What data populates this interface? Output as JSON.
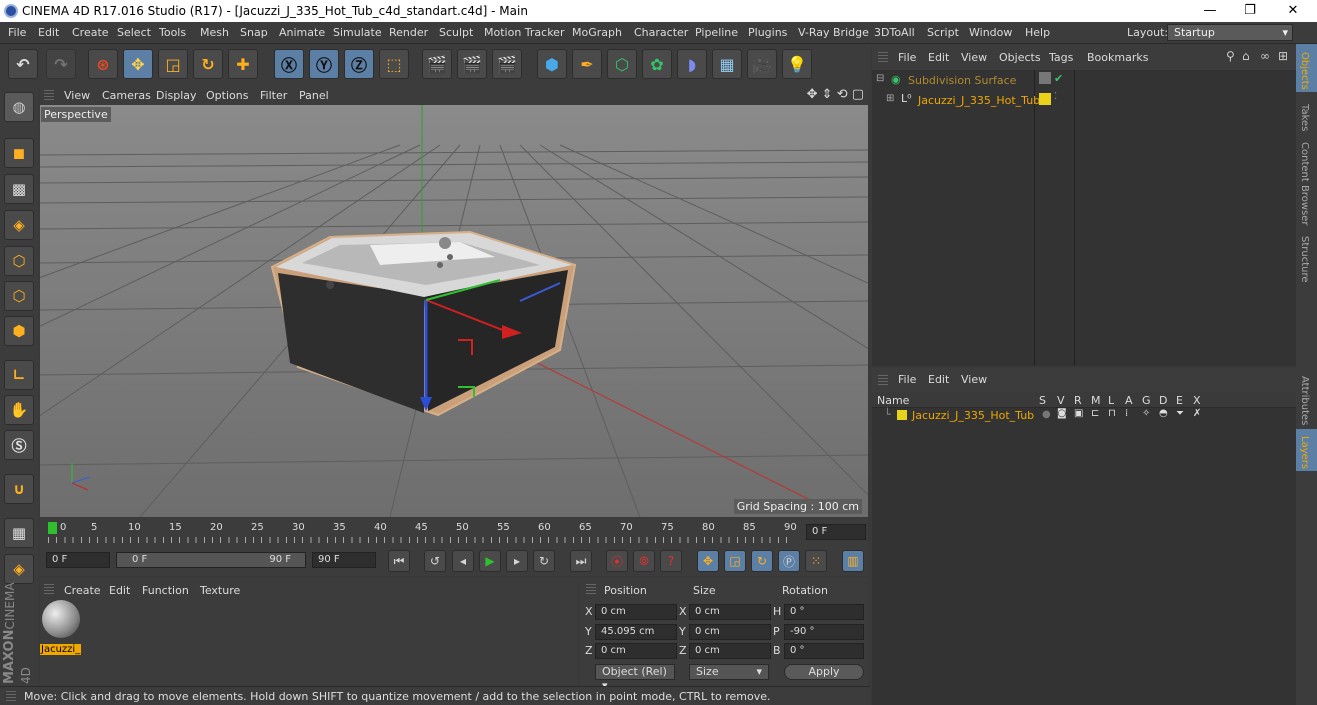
{
  "window": {
    "title": "CINEMA 4D R17.016 Studio (R17) - [Jacuzzi_J_335_Hot_Tub_c4d_standart.c4d] - Main",
    "minimize": "—",
    "restore": "❐",
    "close": "✕"
  },
  "menubar": {
    "items": [
      "File",
      "Edit",
      "Create",
      "Select",
      "Tools",
      "Mesh",
      "Snap",
      "Animate",
      "Simulate",
      "Render",
      "Sculpt",
      "Motion Tracker",
      "MoGraph",
      "Character",
      "Pipeline",
      "Plugins",
      "V-Ray Bridge",
      "3DToAll",
      "Script",
      "Window",
      "Help"
    ],
    "layout_label": "Layout:",
    "layout_value": "Startup"
  },
  "viewport": {
    "menu": [
      "View",
      "Cameras",
      "Display",
      "Options",
      "Filter",
      "Panel"
    ],
    "label": "Perspective",
    "grid_spacing": "Grid Spacing : 100 cm"
  },
  "timeline": {
    "ticks": [
      "0",
      "5",
      "10",
      "15",
      "20",
      "25",
      "30",
      "35",
      "40",
      "45",
      "50",
      "55",
      "60",
      "65",
      "70",
      "75",
      "80",
      "85",
      "90"
    ],
    "current_frame": "0 F"
  },
  "transport": {
    "start": "0 F",
    "range_start": "0 F",
    "range_end": "90 F",
    "end": "90 F"
  },
  "materials": {
    "menu": [
      "Create",
      "Edit",
      "Function",
      "Texture"
    ],
    "item_label": "Jacuzzi_"
  },
  "coords": {
    "headers": {
      "position": "Position",
      "size": "Size",
      "rotation": "Rotation"
    },
    "rows": [
      {
        "pl": "X",
        "pv": "0 cm",
        "sl": "X",
        "sv": "0 cm",
        "rl": "H",
        "rv": "0 °"
      },
      {
        "pl": "Y",
        "pv": "45.095 cm",
        "sl": "Y",
        "sv": "0 cm",
        "rl": "P",
        "rv": "-90 °"
      },
      {
        "pl": "Z",
        "pv": "0 cm",
        "sl": "Z",
        "sv": "0 cm",
        "rl": "B",
        "rv": "0 °"
      }
    ],
    "mode": "Object (Rel)",
    "size_mode": "Size",
    "apply": "Apply"
  },
  "status": "Move: Click and drag to move elements. Hold down SHIFT to quantize movement / add to the selection in point mode, CTRL to remove.",
  "objects": {
    "menu": [
      "File",
      "Edit",
      "View",
      "Objects",
      "Tags",
      "Bookmarks"
    ],
    "items": [
      {
        "name": "Subdivision Surface"
      },
      {
        "name": "Jacuzzi_J_335_Hot_Tub"
      }
    ]
  },
  "layers": {
    "menu": [
      "File",
      "Edit",
      "View"
    ],
    "name_header": "Name",
    "columns": [
      "S",
      "V",
      "R",
      "M",
      "L",
      "A",
      "G",
      "D",
      "E",
      "X"
    ],
    "item": "Jacuzzi_J_335_Hot_Tub"
  },
  "sidetabs": [
    "Objects",
    "Takes",
    "Content Browser",
    "Structure",
    "Attributes",
    "Layers"
  ],
  "brand": {
    "line1": "MAXON",
    "line2": "CINEMA 4D"
  },
  "colors": {
    "accent": "#f0a800",
    "layer_yellow": "#e8d21a",
    "active_tab": "#5c7fa6"
  }
}
